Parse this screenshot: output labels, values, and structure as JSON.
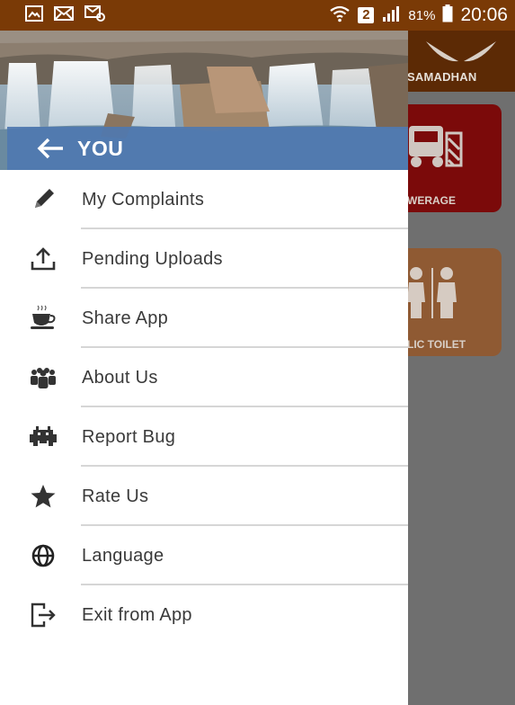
{
  "status_bar": {
    "sim_slot": "2",
    "battery_percent": "81%",
    "time": "20:06",
    "bg_color": "#7a3a06"
  },
  "background_app": {
    "brand": "SAMADHAN",
    "tiles": [
      {
        "label": "WERAGE",
        "color": "#7b0a0a"
      },
      {
        "label": "LIC TOILET",
        "color": "#8f5a33"
      }
    ]
  },
  "drawer": {
    "user_name": "YOU",
    "header_bar_color": "#4f78b0",
    "items": [
      {
        "label": "My Complaints",
        "icon": "pencil-icon"
      },
      {
        "label": "Pending Uploads",
        "icon": "upload-icon"
      },
      {
        "label": "Share App",
        "icon": "coffee-cup-icon"
      },
      {
        "label": "About Us",
        "icon": "people-icon"
      },
      {
        "label": "Report Bug",
        "icon": "bug-icon"
      },
      {
        "label": "Rate Us",
        "icon": "star-icon"
      },
      {
        "label": "Language",
        "icon": "globe-icon"
      },
      {
        "label": "Exit from App",
        "icon": "exit-icon"
      }
    ]
  }
}
